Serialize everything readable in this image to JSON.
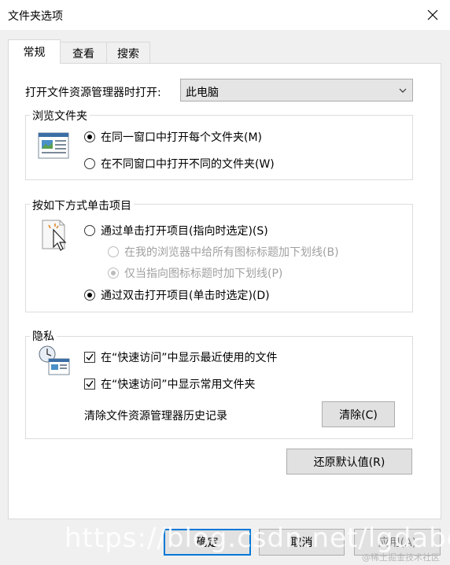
{
  "window": {
    "title": "文件夹选项",
    "close_icon": "close-icon"
  },
  "tabs": [
    {
      "label": "常规",
      "active": true
    },
    {
      "label": "查看",
      "active": false
    },
    {
      "label": "搜索",
      "active": false
    }
  ],
  "open_explorer": {
    "label": "打开文件资源管理器时打开:",
    "selected": "此电脑"
  },
  "browse_folders": {
    "title": "浏览文件夹",
    "option_same": "在同一窗口中打开每个文件夹(M)",
    "option_new": "在不同窗口中打开不同的文件夹(W)",
    "selected": "same"
  },
  "click_items": {
    "title": "按如下方式单击项目",
    "single_click": "通过单击打开项目(指向时选定)(S)",
    "underline_all": "在我的浏览器中给所有图标标题加下划线(B)",
    "underline_point": "仅当指向图标标题时加下划线(P)",
    "double_click": "通过双击打开项目(单击时选定)(D)",
    "selected": "double"
  },
  "privacy": {
    "title": "隐私",
    "show_recent": "在“快速访问”中显示最近使用的文件",
    "show_frequent": "在“快速访问”中显示常用文件夹",
    "show_recent_checked": true,
    "show_frequent_checked": true,
    "clear_label": "清除文件资源管理器历史记录",
    "clear_button": "清除(C)"
  },
  "restore_defaults": "还原默认值(R)",
  "footer": {
    "ok": "确定",
    "cancel": "取消",
    "apply": "应用(A)"
  },
  "watermark": {
    "url": "https://blog.csdn.net/lgdabc",
    "credit": "@稀土掘金技术社区"
  },
  "colors": {
    "accent": "#0078d7",
    "panel_bg": "#ffffff",
    "window_bg": "#f0f0f0"
  }
}
